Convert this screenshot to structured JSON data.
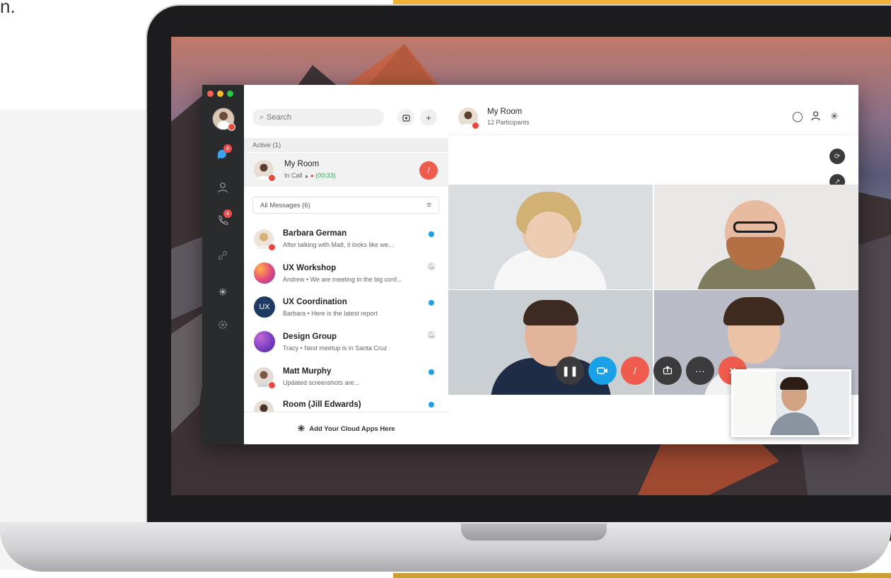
{
  "page": {
    "corner_text": "n."
  },
  "app": {
    "rail": {
      "items": [
        {
          "icon": "chat-bubble-icon",
          "badge": "4"
        },
        {
          "icon": "person-icon"
        },
        {
          "icon": "phone-icon",
          "badge": "4"
        },
        {
          "icon": "link-icon"
        },
        {
          "icon": "cloud-apps-icon"
        },
        {
          "icon": "gear-icon"
        }
      ]
    },
    "search": {
      "placeholder": "Search",
      "icon": "search-icon"
    },
    "active_section": "Active (1)",
    "active_call": {
      "title": "My Room",
      "status": "In Call",
      "timer": "(00:33)"
    },
    "filter": {
      "label": "All Messages (6)"
    },
    "messages": [
      {
        "name": "Barbara German",
        "preview": "After talking with Matt, it looks like we...",
        "indicator": "unread"
      },
      {
        "name": "UX Workshop",
        "preview": "Andrew • We are meeting in the big conf...",
        "indicator": "muted"
      },
      {
        "name": "UX Coordination",
        "preview": "Barbara • Here is the latest report",
        "indicator": "unread",
        "initials": "UX"
      },
      {
        "name": "Design Group",
        "preview": "Tracy • Next meetup is in Santa Cruz",
        "indicator": "muted"
      },
      {
        "name": "Matt Murphy",
        "preview": "Updated screenshots are...",
        "indicator": "unread"
      },
      {
        "name": "Room (Jill Edwards)",
        "preview": "",
        "indicator": "unread"
      }
    ],
    "cloud_apps": "Add Your Cloud Apps Here",
    "room": {
      "title": "My Room",
      "participants": "12 Participants"
    },
    "controls": [
      {
        "name": "pause",
        "color": "#3b3b3d"
      },
      {
        "name": "video",
        "color": "#1aa1e8"
      },
      {
        "name": "mute",
        "color": "#ef5b4c"
      },
      {
        "name": "share",
        "color": "#3b3b3d"
      },
      {
        "name": "more",
        "color": "#3b3b3d"
      },
      {
        "name": "end",
        "color": "#ef5b4c"
      }
    ]
  }
}
